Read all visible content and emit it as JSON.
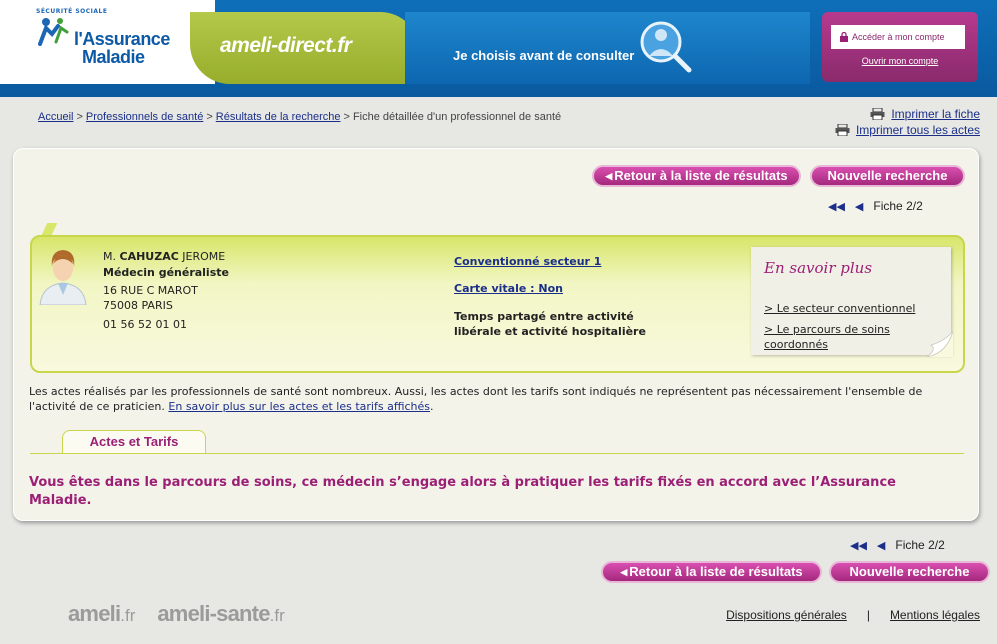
{
  "header": {
    "logo_small": "SÉCURITÉ SOCIALE",
    "logo_line1": "l'Assurance",
    "logo_line2": "Maladie",
    "site_name": "ameli-direct.fr",
    "slogan": "Je choisis avant de consulter",
    "account_button": "Accéder à mon compte",
    "account_create": "Ouvrir mon compte"
  },
  "breadcrumb": {
    "items": [
      "Accueil",
      "Professionnels de santé",
      "Résultats de la recherche"
    ],
    "current": "Fiche détaillée d'un professionnel de santé"
  },
  "print": {
    "print_sheet": "Imprimer la fiche",
    "print_all": "Imprimer tous les actes"
  },
  "nav": {
    "back_label": "Retour à la liste de résultats",
    "new_search_label": "Nouvelle recherche",
    "pager_label": "Fiche 2/2"
  },
  "doctor": {
    "title": "M.",
    "lastname": "CAHUZAC",
    "firstname": "JEROME",
    "specialty": "Médecin généraliste",
    "address1": "16 RUE C MAROT",
    "address2": "75008 PARIS",
    "phone": "01 56 52 01 01",
    "convention": "Conventionné secteur 1",
    "carte_vitale": "Carte vitale : Non",
    "activity_line1": "Temps partagé entre activité",
    "activity_line2": "libérale et activité hospitalière"
  },
  "en_savoir_plus": {
    "title": "En savoir plus",
    "link1": "> Le secteur conventionnel",
    "link2_line1": "> Le parcours de soins",
    "link2_line2": "coordonnés"
  },
  "actes": {
    "notice": "Les actes réalisés par les professionnels de santé sont nombreux. Aussi, les actes dont les tarifs sont indiqués ne représentent pas nécessairement l'ensemble de l'activité de ce praticien.",
    "notice_link": "En savoir plus sur les actes et les tarifs affichés",
    "notice_end": ".",
    "tab_label": "Actes et Tarifs",
    "parcours_text": "Vous êtes dans le parcours de soins, ce médecin s’engage alors à pratiquer les tarifs fixés en accord avec l’Assurance Maladie."
  },
  "footer": {
    "logo1_main": "ameli",
    "logo1_tld": ".fr",
    "logo2_main": "ameli-sante",
    "logo2_tld": ".fr",
    "link1": "Dispositions générales",
    "separator": "|",
    "link2": "Mentions légales"
  },
  "colors": {
    "brand_blue": "#0c5aa6",
    "accent_pink": "#9c1f76",
    "card_green": "#c7d64a"
  }
}
